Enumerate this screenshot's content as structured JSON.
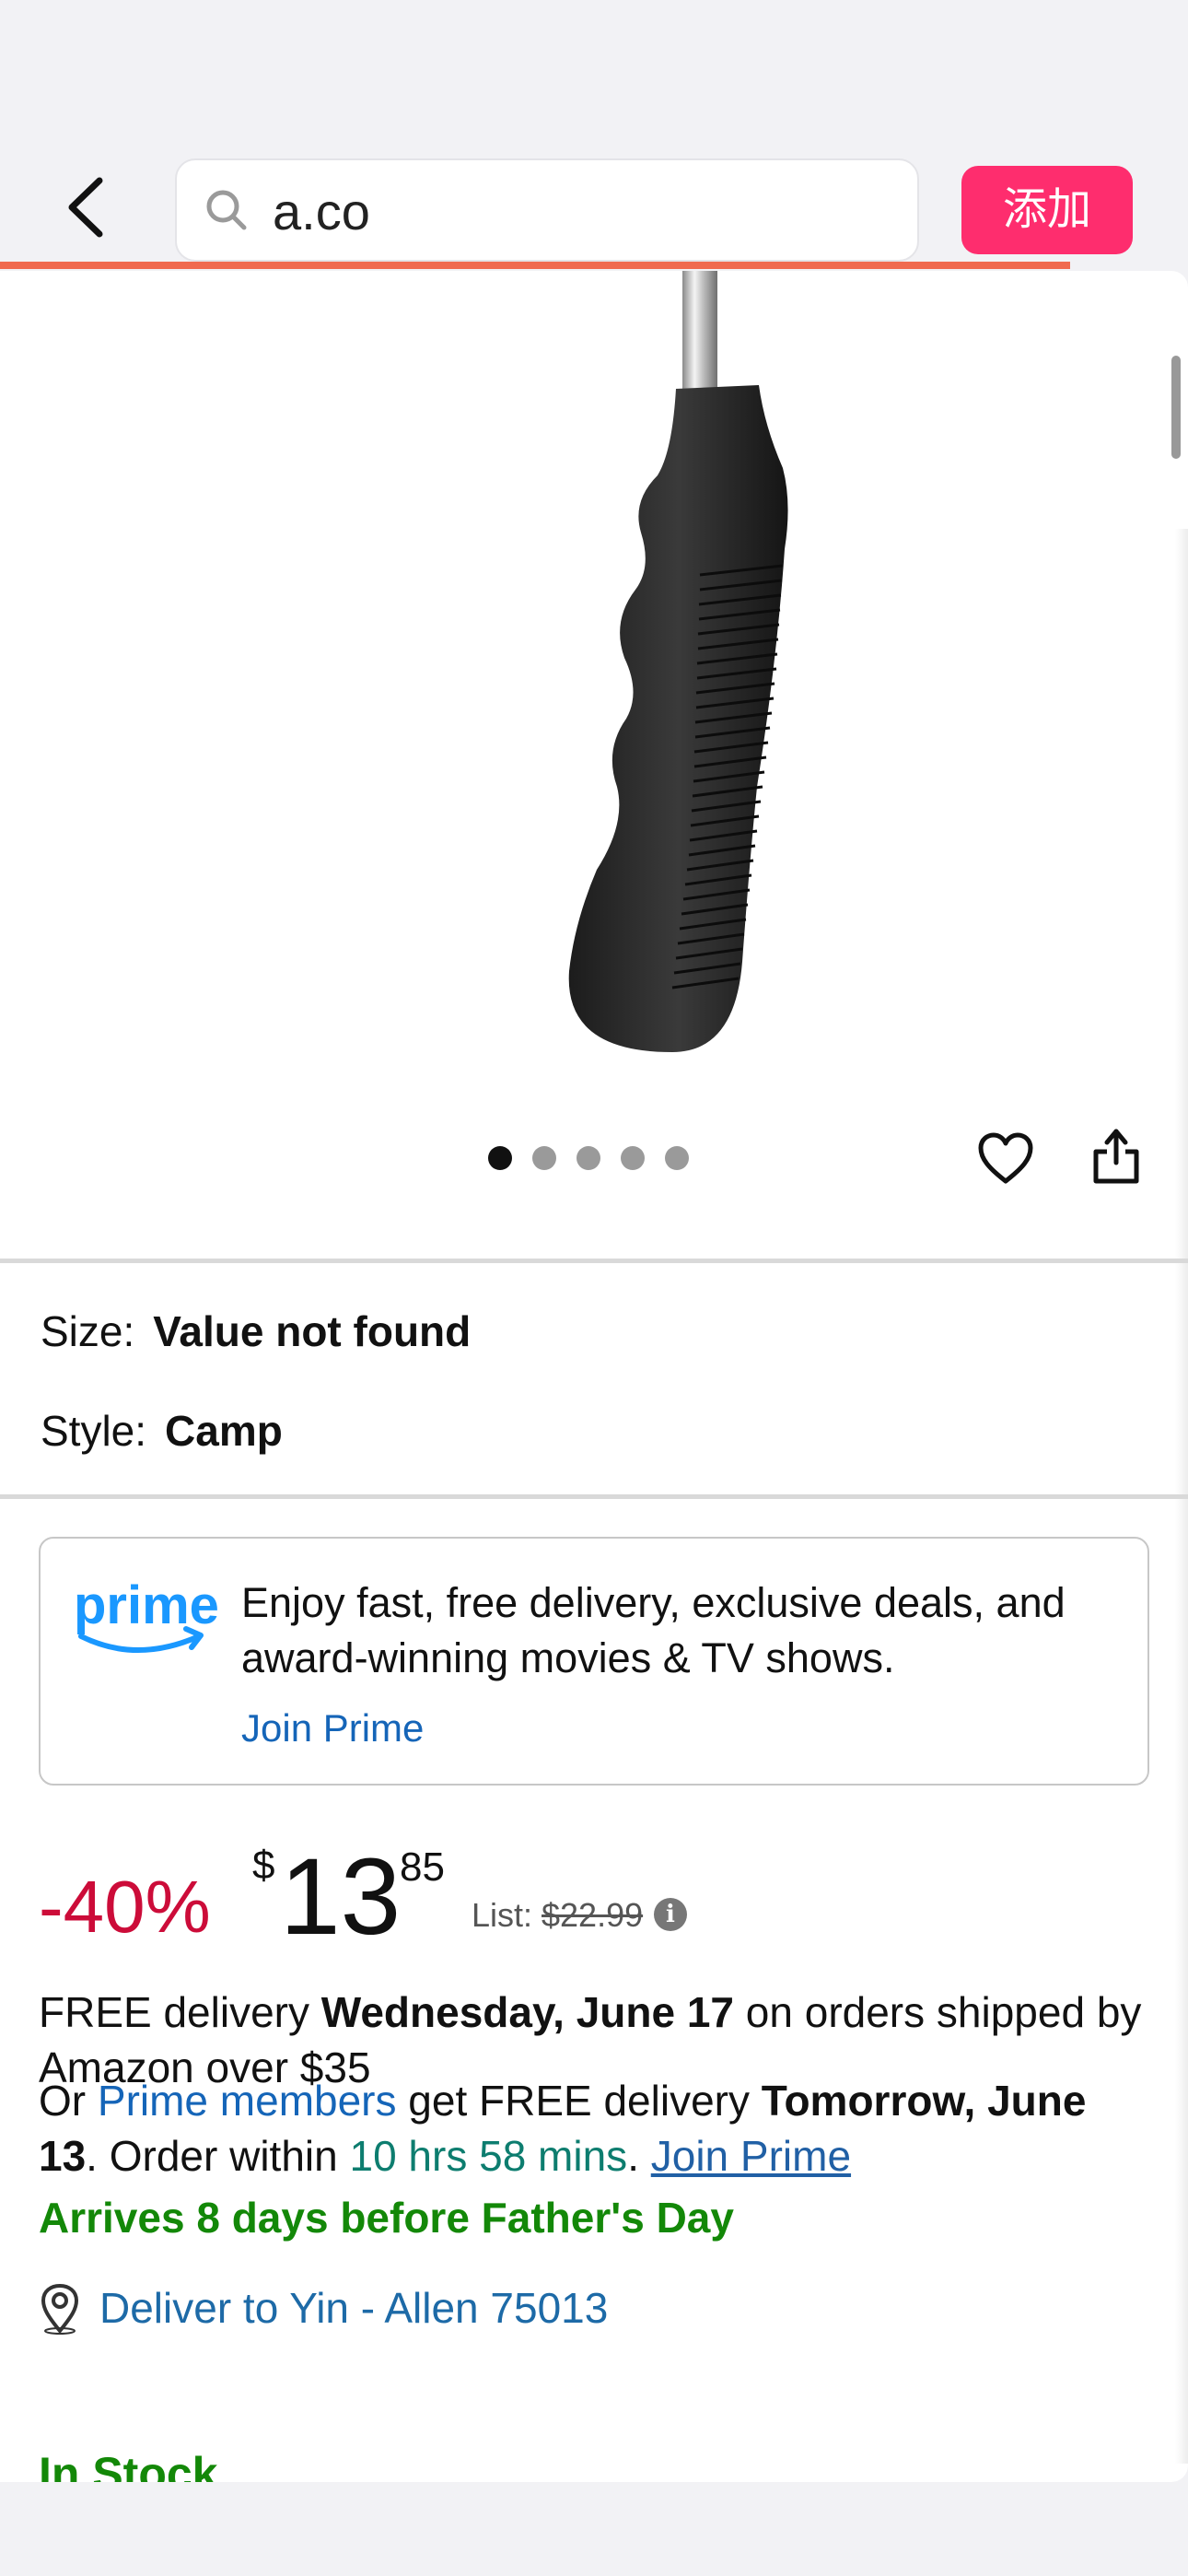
{
  "topbar": {
    "search_text": "a.co",
    "add_label": "添加"
  },
  "gallery": {
    "image_count": 5,
    "active_index": 0
  },
  "variants": {
    "size_label": "Size:",
    "size_value": "Value not found",
    "style_label": "Style:",
    "style_value": "Camp"
  },
  "prime": {
    "logo_text": "prime",
    "message": "Enjoy fast, free delivery, exclusive deals, and award-winning movies & TV shows.",
    "join_label": "Join Prime"
  },
  "price": {
    "discount": "-40%",
    "currency": "$",
    "whole": "13",
    "fraction": "85",
    "list_label": "List:",
    "list_price": "$22.99",
    "info_symbol": "i"
  },
  "delivery": {
    "free_prefix": "FREE delivery ",
    "free_date": "Wednesday, June 17",
    "free_suffix": " on orders shipped by Amazon over $35",
    "or_text": "Or ",
    "prime_members": "Prime members",
    "get_free": " get FREE delivery ",
    "fast_date": "Tomorrow, June 13",
    "order_within": ". Order within ",
    "countdown": "10 hrs 58 mins",
    "period": ". ",
    "join_prime": "Join Prime"
  },
  "arrives": "Arrives 8 days before Father's Day",
  "deliver_to": "Deliver to Yin - Allen 75013",
  "stock": "In Stock",
  "colors": {
    "add_button": "#fe2d6e",
    "progress": "#f06a4f",
    "discount": "#cc0c39",
    "link": "#1565b8",
    "green": "#138808",
    "teal": "#0d7d6f"
  },
  "icons": [
    "chevron-left-icon",
    "search-icon",
    "heart-icon",
    "share-icon",
    "info-icon",
    "location-pin-icon",
    "prime-logo"
  ]
}
